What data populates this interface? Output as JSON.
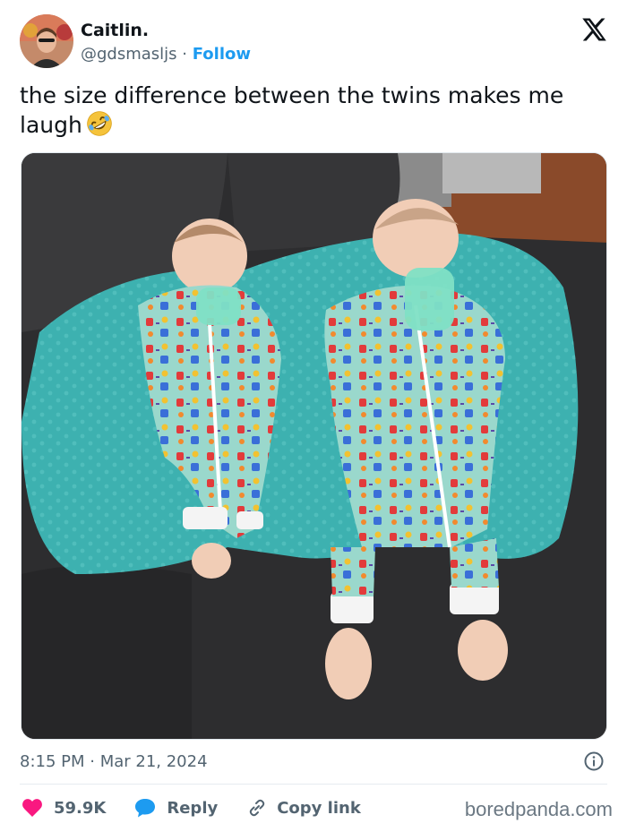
{
  "author": {
    "display_name": "Caitlin.",
    "handle": "@gdsmasljs",
    "separator": " · ",
    "follow_label": "Follow"
  },
  "tweet": {
    "text": "the size difference between the twins makes me laugh",
    "emoji": "rolling-on-the-floor-laughing-emoji",
    "timestamp": "8:15 PM · Mar 21, 2024"
  },
  "actions": {
    "like_count": "59.9K",
    "reply_label": "Reply",
    "copy_label": "Copy link"
  },
  "watermark": "boredpanda.com",
  "colors": {
    "accent": "#1d9bf0",
    "like": "#f91880",
    "text": "#0f1419",
    "muted": "#536471",
    "pillow": "#3fb3b2",
    "onesie": "#8fd3c6",
    "couch": "#2b2b2d"
  },
  "icons": {
    "brand": "x-logo-icon",
    "info": "info-icon",
    "like": "heart-icon",
    "reply": "speech-bubble-icon",
    "copy": "link-icon"
  }
}
